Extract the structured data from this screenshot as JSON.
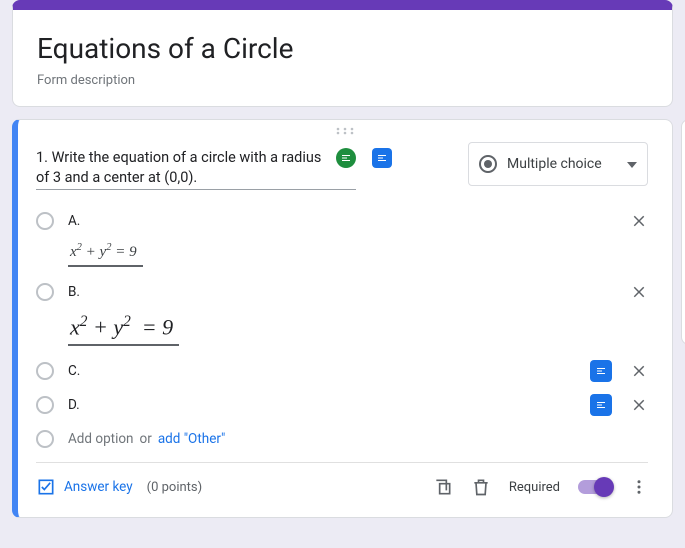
{
  "header": {
    "title": "Equations of a Circle",
    "description": "Form description"
  },
  "question": {
    "text": "1. Write the equation of a circle with a radius of 3 and a center at (0,0).",
    "type_label": "Multiple choice",
    "options": [
      {
        "label": "A.",
        "has_math": true,
        "math_badge": false
      },
      {
        "label": "B.",
        "has_math": true,
        "math_badge": false
      },
      {
        "label": "C.",
        "has_math": false,
        "math_badge": true
      },
      {
        "label": "D.",
        "has_math": false,
        "math_badge": true
      }
    ],
    "add_option": "Add option",
    "or": "or",
    "add_other": "add \"Other\""
  },
  "footer": {
    "answer_key": "Answer key",
    "points": "(0 points)",
    "required": "Required"
  }
}
